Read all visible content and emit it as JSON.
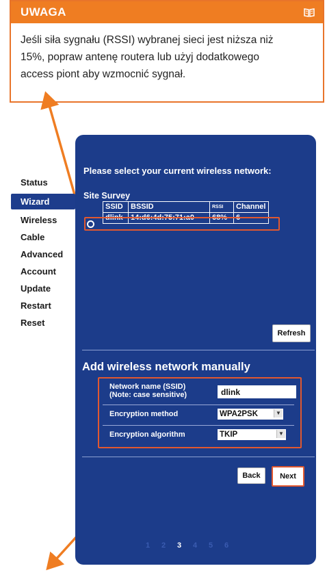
{
  "note": {
    "title": "UWAGA",
    "lines": [
      "Jeśli siła sygnału (RSSI) wybranej sieci jest niższa niż",
      "15%, popraw antenę routera lub użyj dodatkowego",
      "access piont aby wzmocnić sygnał."
    ],
    "icon": "book-icon",
    "accent_color": "#ef7d22"
  },
  "menu": {
    "items": [
      "Status",
      "Wizard",
      "Wireless",
      "Cable",
      "Advanced",
      "Account",
      "Update",
      "Restart",
      "Reset"
    ],
    "active": "Wizard"
  },
  "panel": {
    "prompt": "Please select your current wireless network:",
    "survey_title": "Site Survey",
    "table": {
      "headers": [
        "SSID",
        "BSSID",
        "RSSI",
        "Channel"
      ],
      "rows": [
        [
          "dlink",
          "14:d6:4d:75:71:a0",
          "68%",
          "6"
        ]
      ]
    },
    "refresh_label": "Refresh",
    "manual_title": "Add wireless network manually",
    "form": {
      "ssid_label_line1": "Network name (SSID)",
      "ssid_label_line2": "(Note: case sensitive)",
      "ssid_value": "dlink",
      "encryption_method_label": "Encryption method",
      "encryption_method_value": "WPA2PSK",
      "encryption_algorithm_label": "Encryption algorithm",
      "encryption_algorithm_value": "TKIP"
    },
    "back_label": "Back",
    "next_label": "Next",
    "pages": [
      "1",
      "2",
      "3",
      "4",
      "5",
      "6"
    ],
    "current_page": "3",
    "panel_color": "#1c3c8a",
    "highlight_color": "#e2582f"
  }
}
